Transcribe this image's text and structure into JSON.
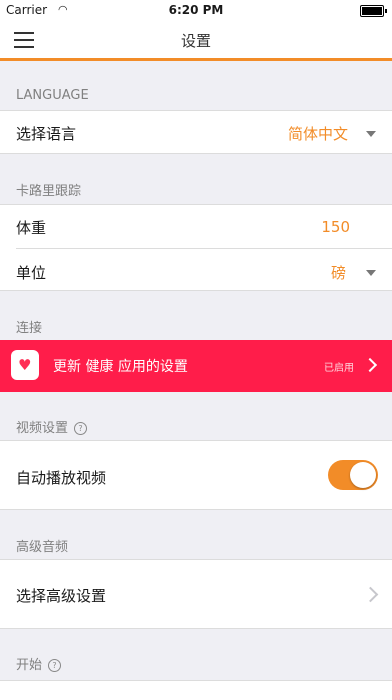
{
  "status_bar": {
    "carrier": "Carrier",
    "time": "6:20 PM"
  },
  "nav": {
    "title": "设置",
    "menu_icon": "hamburger-icon"
  },
  "language": {
    "header": "LANGUAGE",
    "label": "选择语言",
    "value": "简体中文"
  },
  "calorie": {
    "header": "卡路里跟踪",
    "weight_label": "体重",
    "weight_value": "150",
    "unit_label": "单位",
    "unit_value": "磅"
  },
  "connect": {
    "header": "连接",
    "health_label": "更新 健康 应用的设置",
    "health_status": "已启用",
    "health_color": "#ff1d4a"
  },
  "video": {
    "header": "视频设置",
    "autoplay_label": "自动播放视频",
    "autoplay_on": true
  },
  "advanced_audio": {
    "header": "高级音频",
    "label": "选择高级设置"
  },
  "start": {
    "header": "开始"
  },
  "colors": {
    "accent": "#f28c28",
    "background": "#efeff4"
  }
}
